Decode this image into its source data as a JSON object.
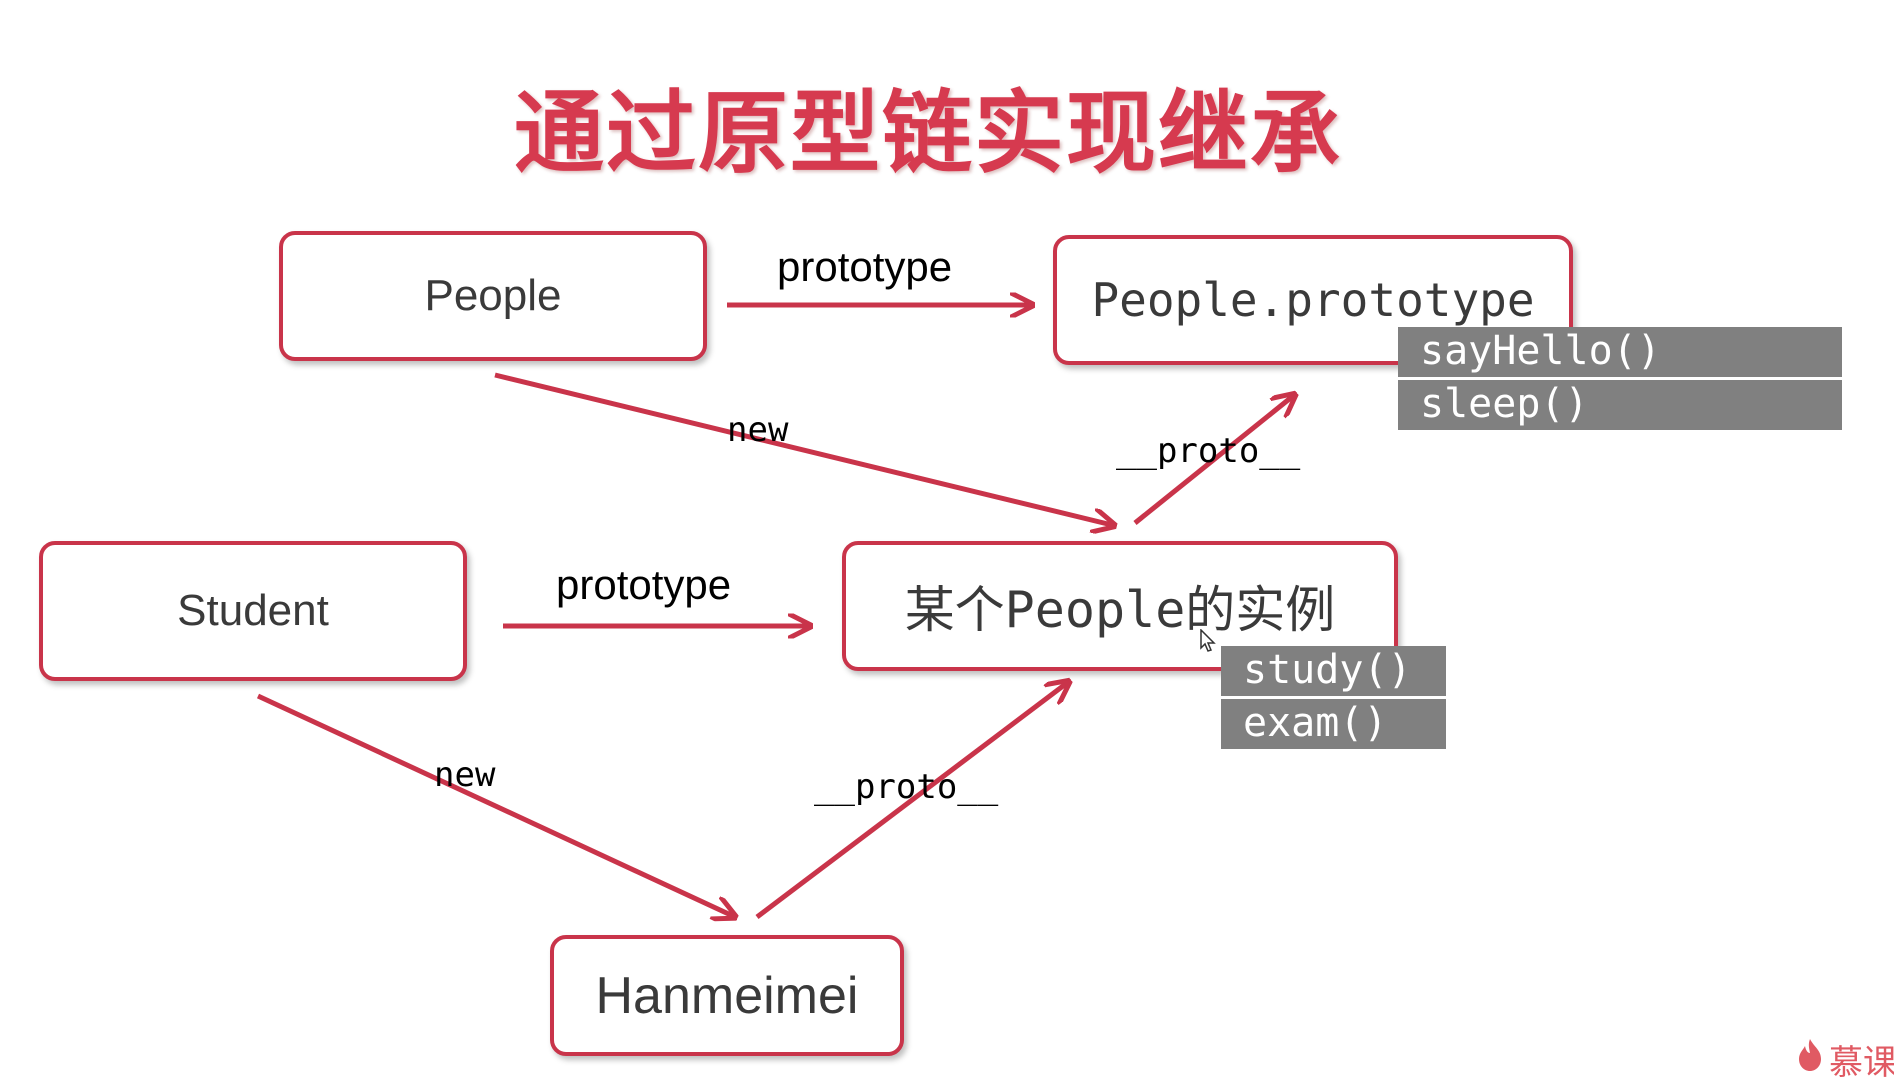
{
  "title": "通过原型链实现继承",
  "nodes": {
    "people": "People",
    "people_prototype": "People.prototype",
    "student": "Student",
    "instance": "某个People的实例",
    "hanmeimei": "Hanmeimei"
  },
  "methods": {
    "people_prototype": [
      "sayHello()",
      "sleep()"
    ],
    "instance": [
      "study()",
      "exam()"
    ]
  },
  "edge_labels": {
    "people_to_prototype": "prototype",
    "student_to_instance": "prototype",
    "people_new": "new",
    "student_new": "new",
    "instance_proto": "__proto__",
    "hanmeimei_proto": "__proto__"
  },
  "watermark": {
    "text": "慕课",
    "icon": "flame-icon"
  },
  "colors": {
    "accent": "#c9344a",
    "title": "#d63a4f",
    "method_bg": "#808080"
  }
}
